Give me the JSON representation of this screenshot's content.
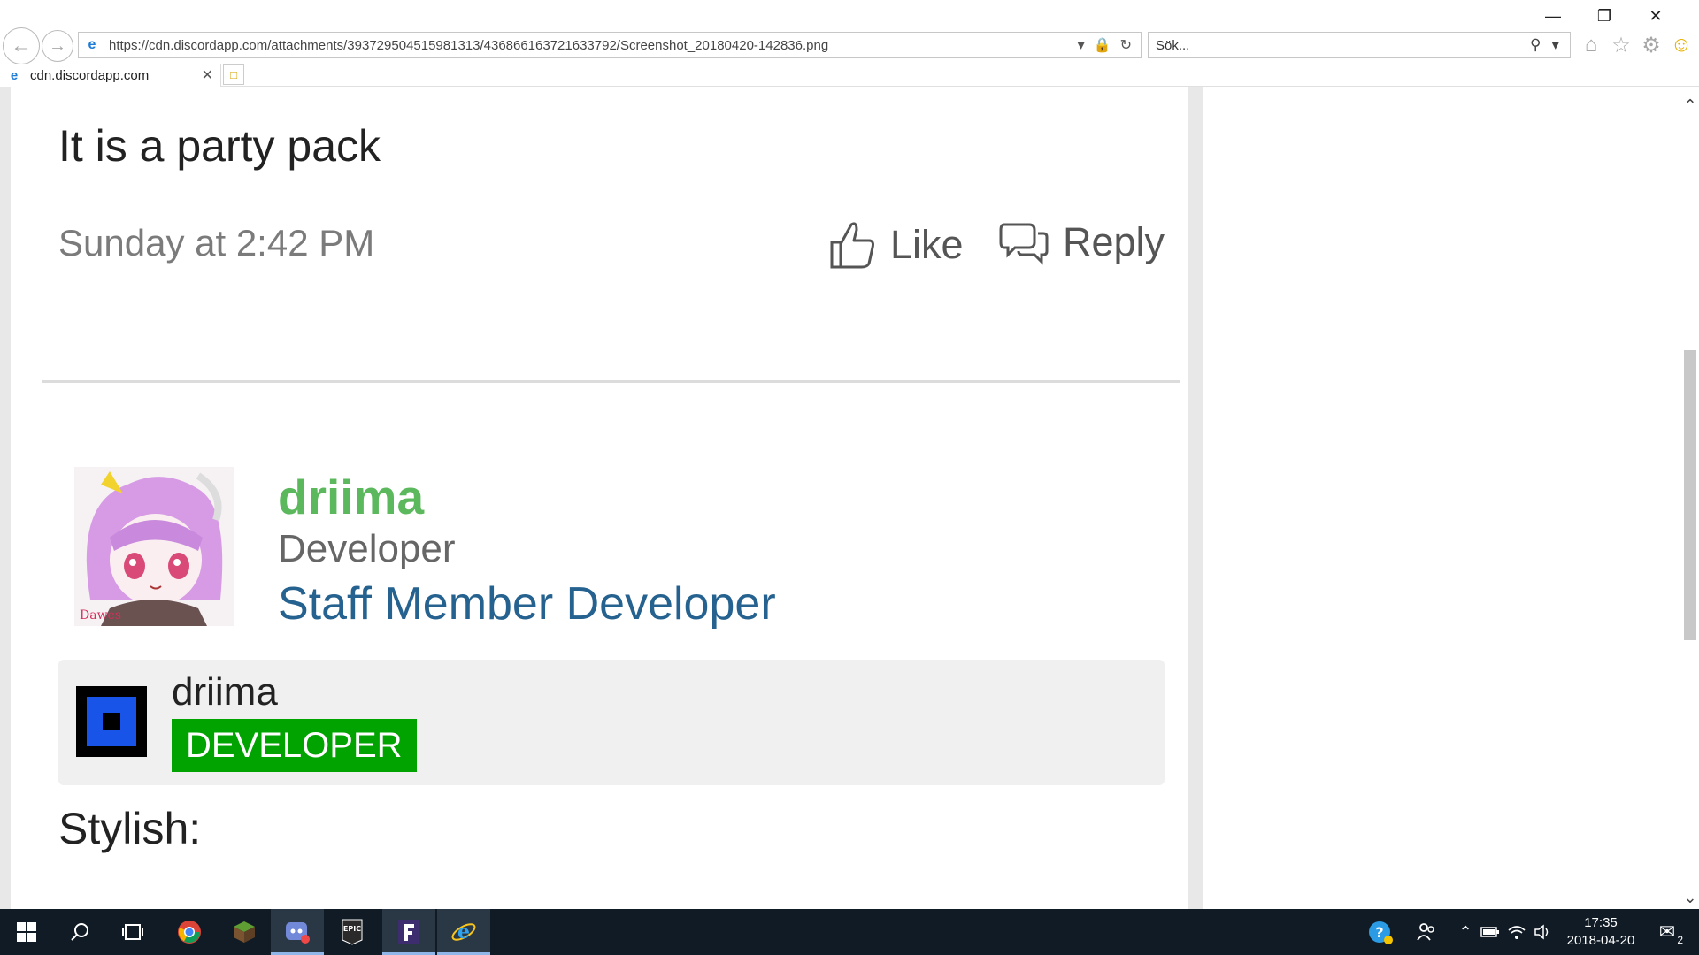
{
  "browser": {
    "url": "https://cdn.discordapp.com/attachments/393729504515981313/436866163721633792/Screenshot_20180420-142836.png",
    "search_placeholder": "Sök...",
    "tab_title": "cdn.discordapp.com"
  },
  "post": {
    "text": "It is a party pack",
    "time": "Sunday at 2:42 PM",
    "like_label": "Like",
    "reply_label": "Reply"
  },
  "user": {
    "name": "driima",
    "title": "Developer",
    "banner": "Staff Member Developer",
    "avatar_signature": "Dawes"
  },
  "quote": {
    "name": "driima",
    "badge": "DEVELOPER"
  },
  "next_post": {
    "text": "Stylish:"
  },
  "taskbar": {
    "time": "17:35",
    "date": "2018-04-20",
    "notification_count": "2",
    "apps": [
      "windows-start",
      "search",
      "task-view",
      "chrome",
      "minecraft",
      "discord",
      "epic-games",
      "fortnite",
      "internet-explorer"
    ]
  },
  "colors": {
    "username": "#5cb85c",
    "banner": "#25628f",
    "badge": "#00a300"
  }
}
